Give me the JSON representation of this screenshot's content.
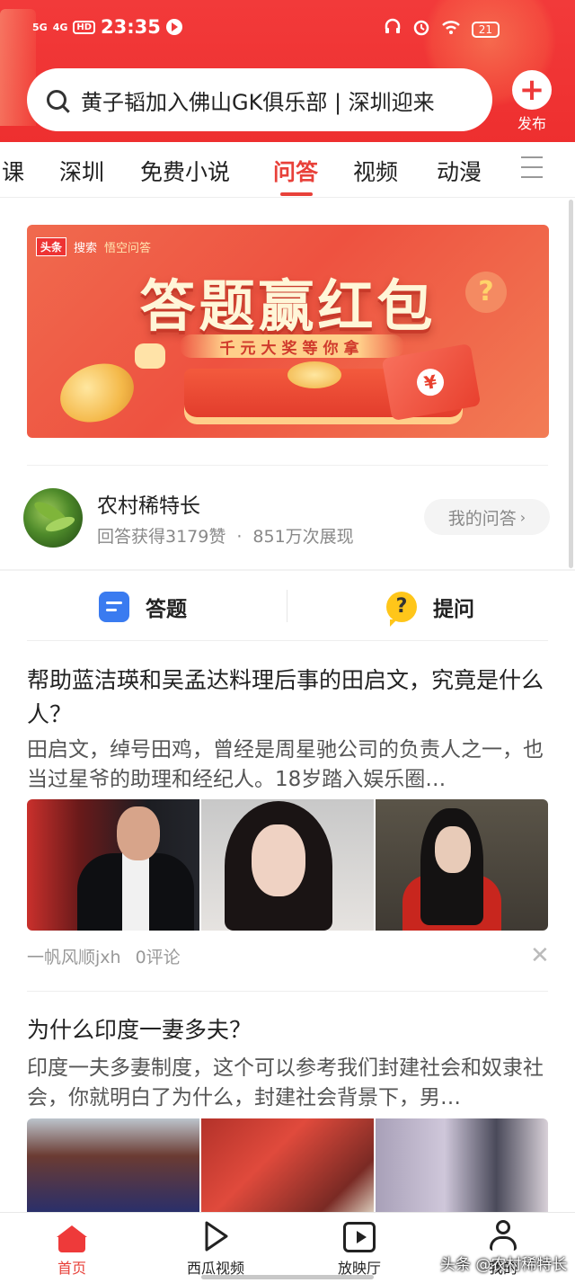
{
  "status_bar": {
    "network_1": "5G",
    "network_2": "4G",
    "hd": "HD",
    "time": "23:35",
    "battery": "21"
  },
  "search": {
    "query": "黄子韬加入佛山GK俱乐部 | 深圳迎来"
  },
  "publish": {
    "label": "发布"
  },
  "tabs": [
    {
      "label": "课"
    },
    {
      "label": "深圳"
    },
    {
      "label": "免费小说"
    },
    {
      "label": "问答",
      "active": true
    },
    {
      "label": "视频"
    },
    {
      "label": "动漫"
    }
  ],
  "banner": {
    "brand": "头条",
    "brand_search": "搜索",
    "brand_partner": "悟空问答",
    "title": "答题赢红包",
    "subtitle": "千元大奖等你拿"
  },
  "profile": {
    "name": "农村稀特长",
    "likes": "回答获得3179赞",
    "separator": "·",
    "views": "851万次展现",
    "my_qa_button": "我的问答"
  },
  "actions": {
    "answer": "答题",
    "ask": "提问"
  },
  "articles": [
    {
      "title": "帮助蓝洁瑛和吴孟达料理后事的田启文，究竟是什么人？",
      "summary": "田启文，绰号田鸡，曾经是周星驰公司的负责人之一，也当过星爷的助理和经纪人。18岁踏入娱乐圈…",
      "author": "一帆风顺jxh",
      "comments": "0评论"
    },
    {
      "title": "为什么印度一妻多夫？",
      "summary": "印度一夫多妻制度，这个可以参考我们封建社会和奴隶社会，你就明白了为什么，封建社会背景下，男…"
    }
  ],
  "bottom_nav": [
    {
      "label": "首页",
      "icon": "home-icon",
      "active": true
    },
    {
      "label": "西瓜视频",
      "icon": "play-icon"
    },
    {
      "label": "放映厅",
      "icon": "cinema-icon"
    },
    {
      "label": "我的",
      "icon": "user-icon"
    }
  ],
  "watermark": "头条 @农村稀特长",
  "colors": {
    "brand_red": "#ee3a3a",
    "active_tab": "#e8413a",
    "answer_icon": "#3a7bf0",
    "ask_icon": "#ffc61a"
  }
}
